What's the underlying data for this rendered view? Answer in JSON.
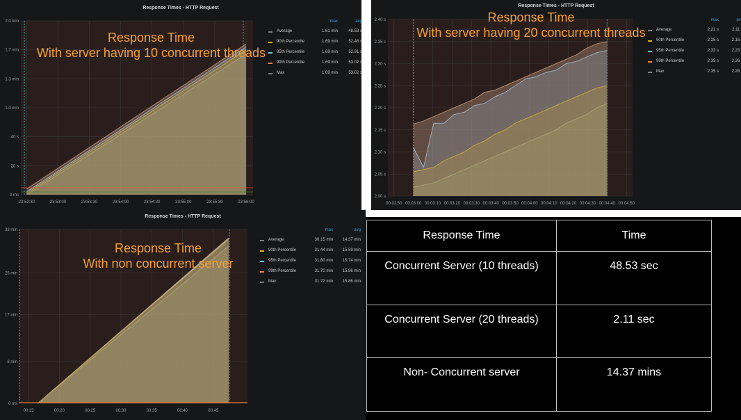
{
  "panels": [
    {
      "title": "Response Times - HTTP Request",
      "overlay": [
        "Response Time",
        "With server having 10 concurrent threads"
      ],
      "legend": {
        "headers": [
          "max",
          "avg"
        ],
        "rows": [
          {
            "name": "Average",
            "max": "1.61 min",
            "avg": "48.53 s",
            "color": "#7f7f7f"
          },
          {
            "name": "90th Percentile",
            "max": "1.69 min",
            "avg": "52.48 s",
            "color": "#e0b400"
          },
          {
            "name": "95th Percentile",
            "max": "1.69 min",
            "avg": "52.91 s",
            "color": "#6ed0e0"
          },
          {
            "name": "99th Percentile",
            "max": "1.69 min",
            "avg": "53.02 s",
            "color": "#ef843c"
          },
          {
            "name": "Max",
            "max": "1.69 min",
            "avg": "53.02 s",
            "color": "#7f7f7f"
          }
        ]
      }
    },
    {
      "title": "Response Times - HTTP Request",
      "overlay": [
        "Response Time",
        "With server having 20 concurrent threads"
      ],
      "legend": {
        "headers": [
          "max",
          "avg"
        ],
        "rows": [
          {
            "name": "Average",
            "max": "2.21 s",
            "avg": "2.11 s",
            "color": "#7f7f7f"
          },
          {
            "name": "90th Percentile",
            "max": "2.25 s",
            "avg": "2.15 s",
            "color": "#e0b400"
          },
          {
            "name": "95th Percentile",
            "max": "2.33 s",
            "avg": "2.23 s",
            "color": "#6ed0e0"
          },
          {
            "name": "99th Percentile",
            "max": "2.35 s",
            "avg": "2.26 s",
            "color": "#ef843c"
          },
          {
            "name": "Max",
            "max": "2.35 s",
            "avg": "2.26 s",
            "color": "#7f7f7f"
          }
        ]
      }
    },
    {
      "title": "Response Times - HTTP Request",
      "overlay": [
        "Response Time",
        "With non concurrent server"
      ],
      "legend": {
        "headers": [
          "max",
          "avg"
        ],
        "rows": [
          {
            "name": "Average",
            "max": "30.15 min",
            "avg": "14.37 min",
            "color": "#7f7f7f"
          },
          {
            "name": "90th Percentile",
            "max": "31.44 min",
            "avg": "15.59 min",
            "color": "#e0b400"
          },
          {
            "name": "95th Percentile",
            "max": "31.60 min",
            "avg": "15.74 min",
            "color": "#6ed0e0"
          },
          {
            "name": "99th Percentile",
            "max": "31.72 min",
            "avg": "15.86 min",
            "color": "#ef843c"
          },
          {
            "name": "Max",
            "max": "31.72 min",
            "avg": "15.86 min",
            "color": "#7f7f7f"
          }
        ]
      }
    }
  ],
  "table": {
    "headers": [
      "Response Time",
      "Time"
    ],
    "rows": [
      [
        "Concurrent Server (10 threads)",
        "48.53 sec"
      ],
      [
        "Concurrent Server (20 threads)",
        "2.11 sec"
      ],
      [
        "Non- Concurrent server",
        "14.37 mins"
      ]
    ]
  },
  "chart_data": [
    {
      "type": "area",
      "title": "Response Times - HTTP Request",
      "x": [
        "23:52:30",
        "23:53:00",
        "23:53:30",
        "23:54:00",
        "23:54:30",
        "23:55:00",
        "23:55:30",
        "23:56:00"
      ],
      "yticks": [
        "0 ms",
        "20 s",
        "40 s",
        "1.0 min",
        "1.3 min",
        "1.7 min",
        "2.0 min"
      ],
      "ylim_seconds": [
        0,
        120
      ],
      "series": [
        {
          "name": "Max",
          "points_seconds": [
            [
              0,
              4
            ],
            [
              7,
              104
            ]
          ]
        },
        {
          "name": "99th Percentile",
          "points_seconds": [
            [
              0,
              4
            ],
            [
              7,
              104
            ]
          ]
        },
        {
          "name": "95th Percentile",
          "points_seconds": [
            [
              0,
              2
            ],
            [
              7,
              102
            ]
          ]
        },
        {
          "name": "90th Percentile",
          "points_seconds": [
            [
              0,
              1
            ],
            [
              7,
              100
            ]
          ]
        },
        {
          "name": "Average",
          "points_seconds": [
            [
              0,
              0
            ],
            [
              7,
              97
            ]
          ]
        }
      ]
    },
    {
      "type": "area",
      "title": "Response Times - HTTP Request",
      "x": [
        "00:02:50",
        "00:03:00",
        "00:03:10",
        "00:03:20",
        "00:03:30",
        "00:03:40",
        "00:03:50",
        "00:04:00",
        "00:04:10",
        "00:04:20",
        "00:04:30",
        "00:04:40",
        "00:04:50"
      ],
      "yticks": [
        "2.00 s",
        "2.05 s",
        "2.10 s",
        "2.15 s",
        "2.20 s",
        "2.25 s",
        "2.30 s",
        "2.35 s",
        "2.40 s"
      ],
      "ylim": [
        2.0,
        2.4
      ],
      "series": [
        {
          "name": "Max",
          "values": [
            2.163,
            2.17,
            2.18,
            2.19,
            2.2,
            2.21,
            2.22,
            2.235,
            2.24,
            2.25,
            2.26,
            2.27,
            2.28,
            2.29,
            2.3,
            2.31,
            2.32,
            2.335,
            2.345,
            2.35
          ]
        },
        {
          "name": "99th Percentile",
          "values": [
            2.163,
            2.17,
            2.18,
            2.19,
            2.2,
            2.21,
            2.22,
            2.235,
            2.24,
            2.25,
            2.26,
            2.27,
            2.28,
            2.29,
            2.3,
            2.31,
            2.32,
            2.335,
            2.345,
            2.35
          ]
        },
        {
          "name": "95th Percentile",
          "values": [
            2.11,
            2.065,
            2.165,
            2.165,
            2.185,
            2.19,
            2.205,
            2.21,
            2.225,
            2.235,
            2.25,
            2.265,
            2.27,
            2.28,
            2.285,
            2.3,
            2.305,
            2.315,
            2.325,
            2.33
          ]
        },
        {
          "name": "90th Percentile",
          "values": [
            2.055,
            2.06,
            2.065,
            2.08,
            2.09,
            2.1,
            2.115,
            2.125,
            2.14,
            2.15,
            2.165,
            2.175,
            2.185,
            2.195,
            2.205,
            2.215,
            2.225,
            2.235,
            2.245,
            2.25
          ]
        },
        {
          "name": "Average",
          "values": [
            2.02,
            2.025,
            2.03,
            2.04,
            2.05,
            2.06,
            2.07,
            2.08,
            2.09,
            2.1,
            2.11,
            2.12,
            2.13,
            2.14,
            2.15,
            2.165,
            2.175,
            2.185,
            2.2,
            2.21
          ]
        }
      ]
    },
    {
      "type": "area",
      "title": "Response Times - HTTP Request",
      "x": [
        "00:15",
        "00:20",
        "00:25",
        "00:30",
        "00:35",
        "00:40",
        "00:45"
      ],
      "yticks": [
        "0 ms",
        "8 min",
        "17 min",
        "25 min",
        "33 min"
      ],
      "ylim_minutes": [
        0,
        33.33
      ],
      "series": [
        {
          "name": "Max",
          "points_minutes": [
            [
              0.3,
              0
            ],
            [
              6.5,
              31.72
            ]
          ]
        },
        {
          "name": "99th Percentile",
          "points_minutes": [
            [
              0.3,
              0
            ],
            [
              6.5,
              31.72
            ]
          ]
        },
        {
          "name": "95th Percentile",
          "points_minutes": [
            [
              0.3,
              0
            ],
            [
              6.5,
              31.6
            ]
          ]
        },
        {
          "name": "90th Percentile",
          "points_minutes": [
            [
              0.3,
              0
            ],
            [
              6.5,
              31.44
            ]
          ]
        },
        {
          "name": "Average",
          "points_minutes": [
            [
              0.3,
              0
            ],
            [
              6.5,
              30.15
            ]
          ]
        }
      ]
    }
  ]
}
